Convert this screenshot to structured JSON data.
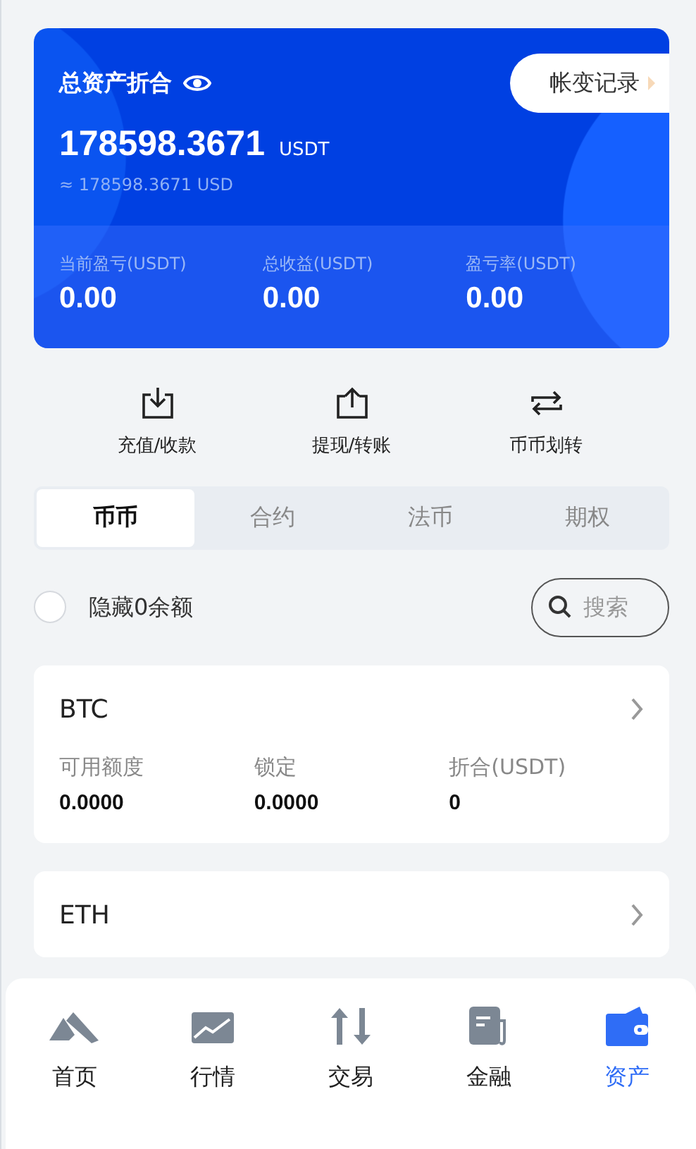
{
  "summary": {
    "title": "总资产折合",
    "history_button": "帐变记录",
    "total": "178598.3671",
    "unit": "USDT",
    "approx": "≈ 178598.3671 USD",
    "stats": [
      {
        "label": "当前盈亏(USDT)",
        "value": "0.00"
      },
      {
        "label": "总收益(USDT)",
        "value": "0.00"
      },
      {
        "label": "盈亏率(USDT)",
        "value": "0.00"
      }
    ]
  },
  "actions": [
    {
      "kind": "deposit",
      "label": "充值/收款"
    },
    {
      "kind": "withdraw",
      "label": "提现/转账"
    },
    {
      "kind": "transfer",
      "label": "币币划转"
    }
  ],
  "tabs": [
    {
      "label": "币币",
      "selected": true
    },
    {
      "label": "合约",
      "selected": false
    },
    {
      "label": "法币",
      "selected": false
    },
    {
      "label": "期权",
      "selected": false
    }
  ],
  "hide_zero": {
    "label": "隐藏0余额",
    "checked": false
  },
  "search": {
    "placeholder": "搜索"
  },
  "assets": [
    {
      "name": "BTC",
      "fields": [
        {
          "label": "可用额度",
          "value": "0.0000"
        },
        {
          "label": "锁定",
          "value": "0.0000"
        },
        {
          "label": "折合(USDT)",
          "value": "0"
        }
      ]
    },
    {
      "name": "ETH"
    }
  ],
  "nav": [
    {
      "kind": "home",
      "label": "首页",
      "selected": false
    },
    {
      "kind": "market",
      "label": "行情",
      "selected": false
    },
    {
      "kind": "trade",
      "label": "交易",
      "selected": false
    },
    {
      "kind": "finance",
      "label": "金融",
      "selected": false
    },
    {
      "kind": "assets",
      "label": "资产",
      "selected": true
    }
  ]
}
